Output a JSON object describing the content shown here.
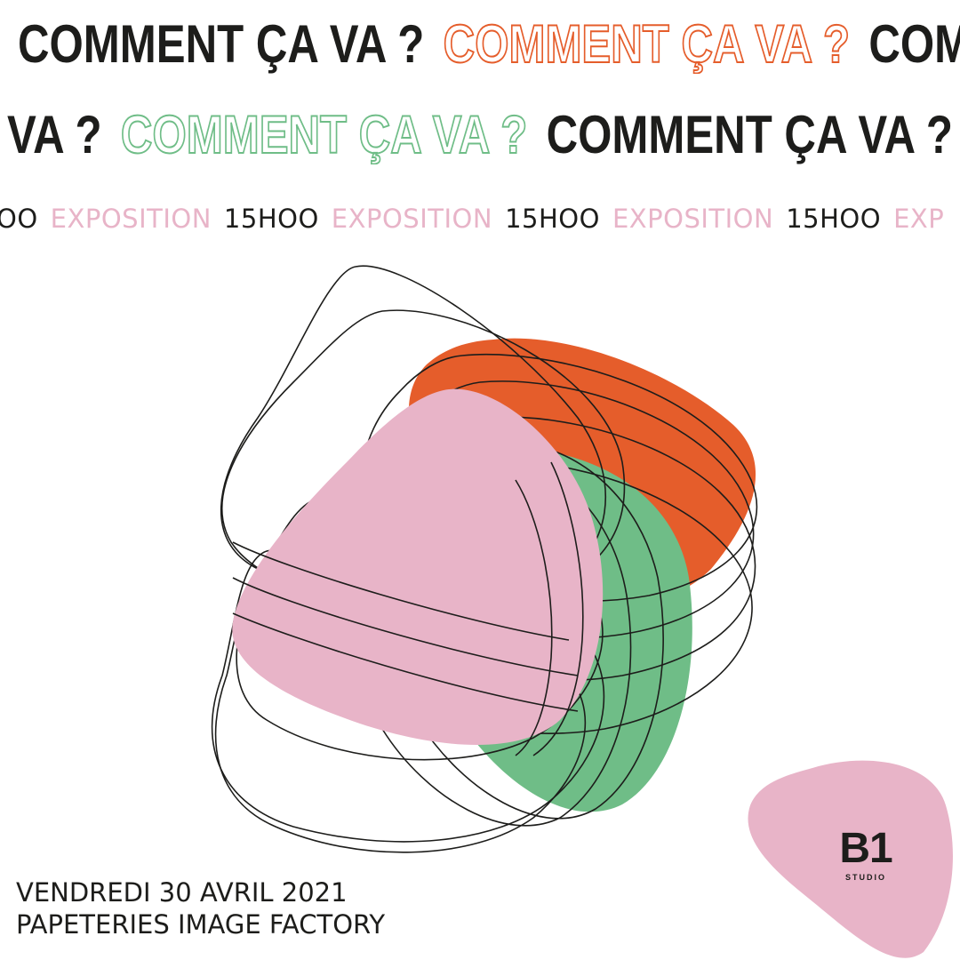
{
  "headline": {
    "text": "COMMENT ÇA VA ?",
    "row1": [
      "COMMENT ÇA VA ?",
      "COMMENT ÇA VA ?",
      "COM"
    ],
    "row2": [
      "VA ?",
      "COMMENT ÇA VA ?",
      "COMMENT ÇA VA ?"
    ]
  },
  "ticker": {
    "items": [
      "OO",
      "EXPOSITION",
      "15HOO",
      "EXPOSITION",
      "15HOO",
      "EXPOSITION",
      "15HOO",
      "EXP"
    ]
  },
  "event": {
    "date": "VENDREDI 30 AVRIL 2021",
    "venue": "PAPETERIES IMAGE FACTORY"
  },
  "logo": {
    "main": "B1",
    "sub": "STUDIO"
  },
  "colors": {
    "orange": "#e55d2b",
    "green": "#6fbd87",
    "pink": "#e8b4c8",
    "ink": "#1d1d1b"
  }
}
